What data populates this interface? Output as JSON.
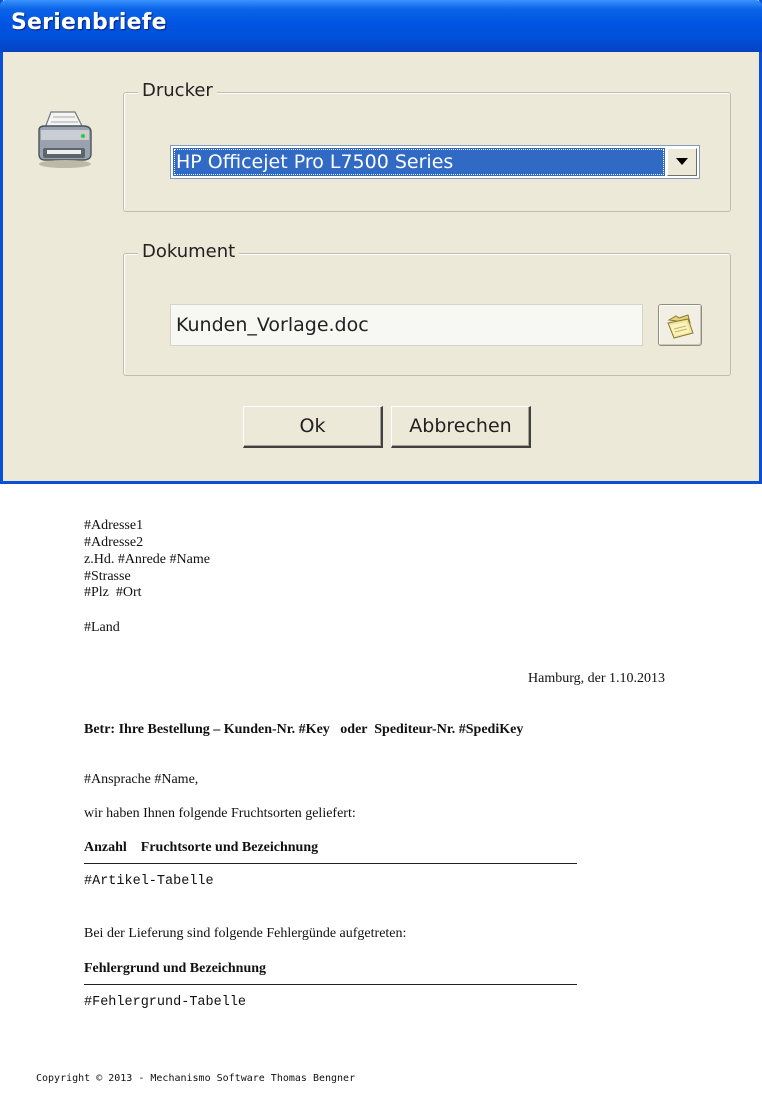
{
  "dialog": {
    "title": "Serienbriefe",
    "printer_group": {
      "legend": "Drucker",
      "selected_printer": "HP Officejet Pro L7500 Series"
    },
    "document_group": {
      "legend": "Dokument",
      "file_value": "Kunden_Vorlage.doc"
    },
    "buttons": {
      "ok": "Ok",
      "cancel": "Abbrechen"
    },
    "icons": [
      "printer-icon",
      "chevron-down-icon",
      "open-folder-icon"
    ],
    "colors": {
      "titlebar": "#0054e3",
      "dialog_bg": "#ece9d8",
      "selection": "#316ac5"
    }
  },
  "letter": {
    "address": [
      "#Adresse1",
      "#Adresse2",
      "z.Hd. #Anrede #Name",
      "#Strasse",
      "#Plz  #Ort"
    ],
    "country": "#Land",
    "date_line": "Hamburg, der 1.10.2013",
    "subject": "Betr: Ihre Bestellung – Kunden-Nr. #Key   oder  Spediteur-Nr. #SpediKey",
    "salutation": "#Ansprache #Name,",
    "intro": "wir haben Ihnen folgende Fruchtsorten geliefert:",
    "article_header": "Anzahl    Fruchtsorte und Bezeichnung",
    "article_table": "#Artikel-Tabelle",
    "errors_intro": "Bei der Lieferung sind folgende Fehlergünde aufgetreten:",
    "errors_header": "Fehlergrund und Bezeichnung",
    "errors_table": "#Fehlergrund-Tabelle",
    "copyright": "Copyright © 2013 - Mechanismo Software Thomas Bengner"
  }
}
